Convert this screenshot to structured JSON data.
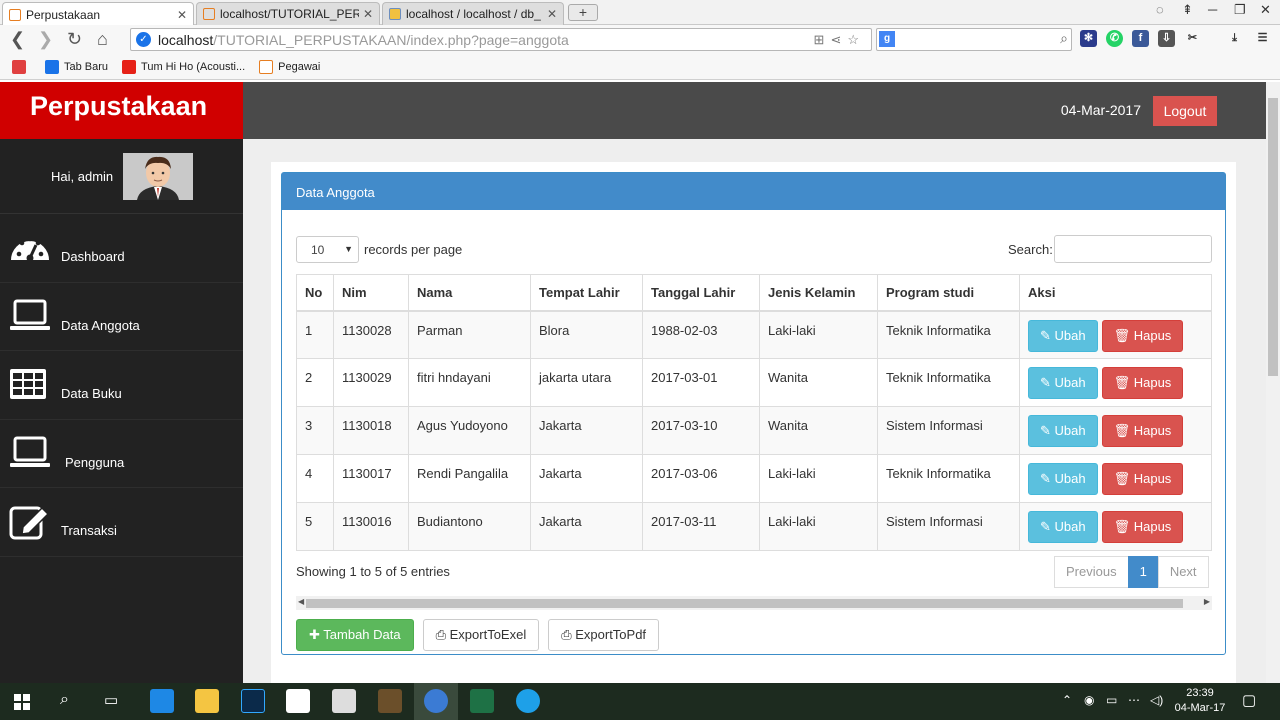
{
  "browser": {
    "tabs": [
      {
        "title": "Perpustakaan",
        "active": true
      },
      {
        "title": "localhost/TUTORIAL_PERP",
        "active": false
      },
      {
        "title": "localhost / localhost / db_",
        "active": false
      }
    ],
    "url_host": "localhost",
    "url_path": "/TUTORIAL_PERPUSTAKAAN/index.php?page=anggota",
    "bookmarks": [
      {
        "label": "Tab Baru",
        "color": "#1a73e8"
      },
      {
        "label": "Tum Hi Ho (Acousti...",
        "color": "#e62117"
      },
      {
        "label": "Pegawai",
        "color": "#e67e22"
      }
    ]
  },
  "app": {
    "brand": "Perpustakaan",
    "greeting": "Hai, admin",
    "date": "04-Mar-2017",
    "logout_label": "Logout",
    "menu": [
      {
        "label": "Dashboard",
        "icon": "dashboard-icon"
      },
      {
        "label": "Data Anggota",
        "icon": "laptop-icon"
      },
      {
        "label": "Data Buku",
        "icon": "table-icon"
      },
      {
        "label": "Pengguna",
        "icon": "laptop-icon"
      },
      {
        "label": "Transaksi",
        "icon": "edit-icon"
      }
    ],
    "colors": {
      "brand": "#d00000",
      "sidebar": "#222222",
      "panel_header": "#428bca",
      "edit": "#5bc0de",
      "delete": "#d9534f",
      "add": "#5cb85c"
    }
  },
  "panel": {
    "title": "Data Anggota",
    "length_value": "10",
    "length_text": "records per page",
    "search_label": "Search:",
    "columns": [
      "No",
      "Nim",
      "Nama",
      "Tempat Lahir",
      "Tanggal Lahir",
      "Jenis Kelamin",
      "Program studi",
      "Aksi"
    ],
    "rows": [
      [
        "1",
        "1130028",
        "Parman",
        "Blora",
        "1988-02-03",
        "Laki-laki",
        "Teknik Informatika"
      ],
      [
        "2",
        "1130029",
        "fitri hndayani",
        "jakarta utara",
        "2017-03-01",
        "Wanita",
        "Teknik Informatika"
      ],
      [
        "3",
        "1130018",
        "Agus Yudoyono",
        "Jakarta",
        "2017-03-10",
        "Wanita",
        "Sistem Informasi"
      ],
      [
        "4",
        "1130017",
        "Rendi Pangalila",
        "Jakarta",
        "2017-03-06",
        "Laki-laki",
        "Teknik Informatika"
      ],
      [
        "5",
        "1130016",
        "Budiantono",
        "Jakarta",
        "2017-03-11",
        "Laki-laki",
        "Sistem Informasi"
      ]
    ],
    "edit_label": "Ubah",
    "delete_label": "Hapus",
    "info": "Showing 1 to 5 of 5 entries",
    "pager": {
      "previous": "Previous",
      "current": "1",
      "next": "Next"
    },
    "add_label": "Tambah Data",
    "export_excel_label": "ExportToExel",
    "export_pdf_label": "ExportToPdf"
  },
  "taskbar": {
    "time": "23:39",
    "date": "04-Mar-17"
  }
}
